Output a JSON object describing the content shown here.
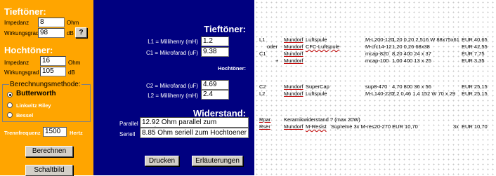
{
  "left": {
    "tieftoener_title": "Tieftöner:",
    "impedanz_label": "Impedanz",
    "impedanz_value": "8",
    "impedanz_unit": "Ohm",
    "wirkungsgrad_label": "Wirkungsgrad",
    "wirkungsgrad_value": "98",
    "wirkungsgrad_unit": "dB",
    "help_label": "?",
    "hochtoener_title": "Hochtöner:",
    "ht_impedanz_label": "Impedanz",
    "ht_impedanz_value": "16",
    "ht_impedanz_unit": "Ohm",
    "ht_wirkungsgrad_label": "Wirkungsgrad",
    "ht_wirkungsgrad_value": "105",
    "ht_wirkungsgrad_unit": "dB",
    "method_title": "Berechnungsmethode:",
    "methods": [
      "Butterworth",
      "Linkwitz Riley",
      "Bessel"
    ],
    "selected_method": "Butterworth",
    "trennfrequenz_label": "Trennfrequenz",
    "trennfrequenz_value": "1500",
    "trennfrequenz_unit": "Hertz",
    "berechnen_label": "Berechnen",
    "schaltbild_label": "Schaltbild"
  },
  "mid": {
    "tieftoener_title": "Tieftöner:",
    "l1_label": "L1 = Millihenry (mH)",
    "l1_value": "1.2",
    "c1_label": "C1 = Mikrofarad (uF)",
    "c1_value": "9.38",
    "hochtoener_title": "Hochtöner:",
    "c2_label": "C2 = Mikrofarad (uF)",
    "c2_value": "4.69",
    "l2_label": "L2 = Millihenry (mH)",
    "l2_value": "2.4",
    "widerstand_title": "Widerstand:",
    "parallel_label": "Parallel",
    "parallel_value": "12.92 Ohm parallel zum Hochtoene",
    "seriell_label": "Seriell",
    "seriell_value": "8.85 Ohm seriell zum Hochtoener",
    "drucken_label": "Drucken",
    "erlaeuterungen_label": "Erläuterungen"
  },
  "parts": {
    "r1": {
      "ref": "L1",
      "brand": "Mundorf",
      "name": "Luftspule",
      "code": "M-L200-120",
      "spec": "1,20 0,20 2,516 W 88x75x61",
      "price": "EUR 40,65"
    },
    "r2": {
      "prefix": "oder",
      "brand": "Mundorf",
      "name": "CFC-Luftspule",
      "code": "M-cfc14-12",
      "spec": "1,20 0,26 68x38",
      "price": "EUR 42,55"
    },
    "r3": {
      "ref": "C1",
      "brand": "Mundorf",
      "code": "mcap-820",
      "spec": "8,20 400 24 x 37",
      "price": "EUR 7,75"
    },
    "r4": {
      "prefix": "+",
      "brand": "Mundorf",
      "code": "mcap-100",
      "spec": "1,00 400 13 x 25",
      "price": "EUR 3,35"
    },
    "r5": {
      "ref": "C2",
      "brand": "Mundorf",
      "name": "SuperCap",
      "code": "sup8-470",
      "spec": "4,70 800 36 x 56",
      "price": "EUR 25,15"
    },
    "r6": {
      "ref": "L2",
      "brand": "Mundorf",
      "name": "Luftspule",
      "code": "M-L140-220",
      "spec": "2,2 0,46 1,4 152 W 70 x 29",
      "price": "EUR 25,15"
    },
    "r7": {
      "ref": "Rpar",
      "text": "Keramikwiderstand ? (max 20W)"
    },
    "r8": {
      "ref": "Rser",
      "brand": "Mundorf",
      "name": "M-Resist",
      "rest": "Supreme  3x  M-res20-270  EUR 10,70",
      "qty": "3x",
      "price": "EUR 10,70"
    }
  }
}
